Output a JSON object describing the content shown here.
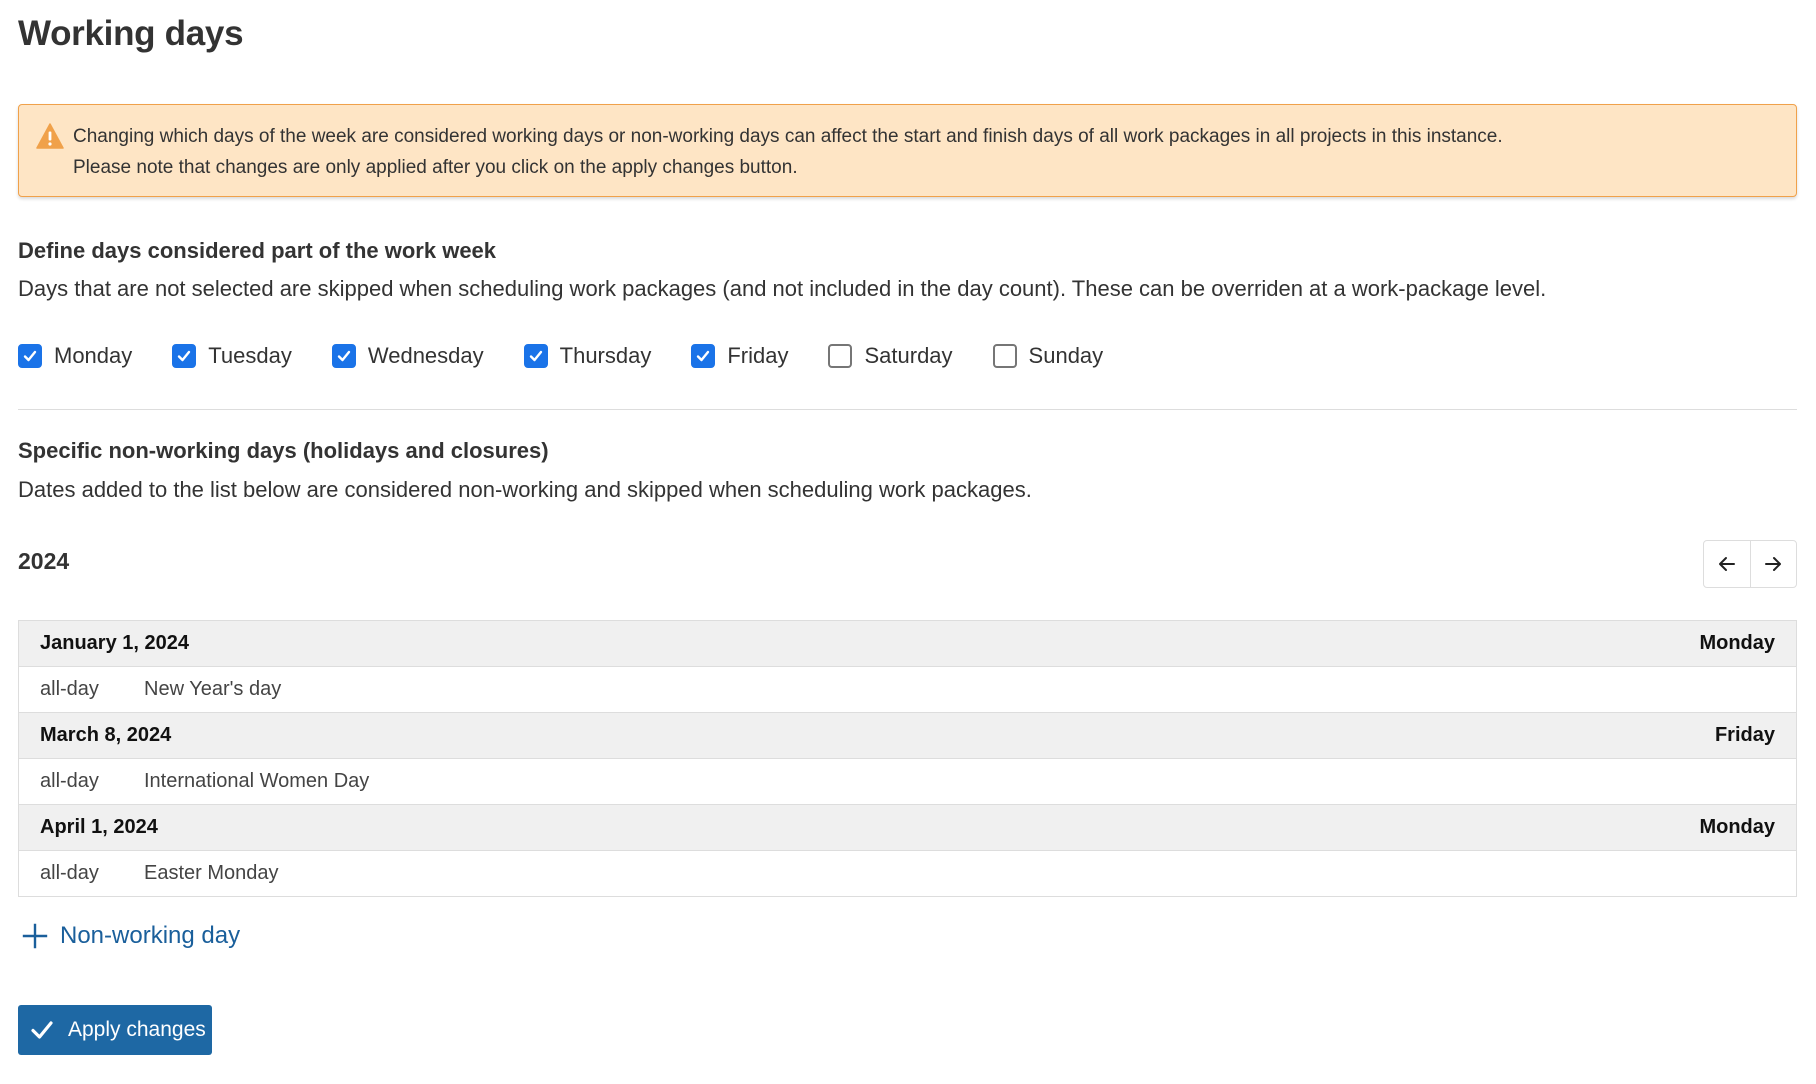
{
  "page": {
    "title": "Working days"
  },
  "alert": {
    "icon": "warning-triangle-icon",
    "line1": "Changing which days of the week are considered working days or non-working days can affect the start and finish days of all work packages in all projects in this instance.",
    "line2": "Please note that changes are only applied after you click on the apply changes button.",
    "colors": {
      "background": "#fee5c5",
      "border": "#f0a14a",
      "icon": "#f0a14a"
    }
  },
  "work_week": {
    "heading": "Define days considered part of the work week",
    "description": "Days that are not selected are skipped when scheduling work packages (and not included in the day count). These can be overriden at a work-package level.",
    "days": [
      {
        "label": "Monday",
        "checked": true
      },
      {
        "label": "Tuesday",
        "checked": true
      },
      {
        "label": "Wednesday",
        "checked": true
      },
      {
        "label": "Thursday",
        "checked": true
      },
      {
        "label": "Friday",
        "checked": true
      },
      {
        "label": "Saturday",
        "checked": false
      },
      {
        "label": "Sunday",
        "checked": false
      }
    ]
  },
  "non_working": {
    "heading": "Specific non-working days (holidays and closures)",
    "description": "Dates added to the list below are considered non-working and skipped when scheduling work packages.",
    "year": "2024",
    "prev_icon": "arrow-left-icon",
    "next_icon": "arrow-right-icon",
    "entries": [
      {
        "date": "January 1, 2024",
        "weekday": "Monday",
        "time": "all-day",
        "name": "New Year's day"
      },
      {
        "date": "March 8, 2024",
        "weekday": "Friday",
        "time": "all-day",
        "name": "International Women Day"
      },
      {
        "date": "April 1, 2024",
        "weekday": "Monday",
        "time": "all-day",
        "name": "Easter Monday"
      }
    ],
    "add_label": "Non-working day",
    "add_icon": "plus-icon"
  },
  "actions": {
    "apply_label": "Apply changes",
    "apply_icon": "checkmark-icon"
  },
  "colors": {
    "primary": "#1e68a4",
    "checkbox": "#1a73e8",
    "link": "#1a5f9b",
    "row_header_bg": "#f0f0f0",
    "border": "#dddddd"
  }
}
